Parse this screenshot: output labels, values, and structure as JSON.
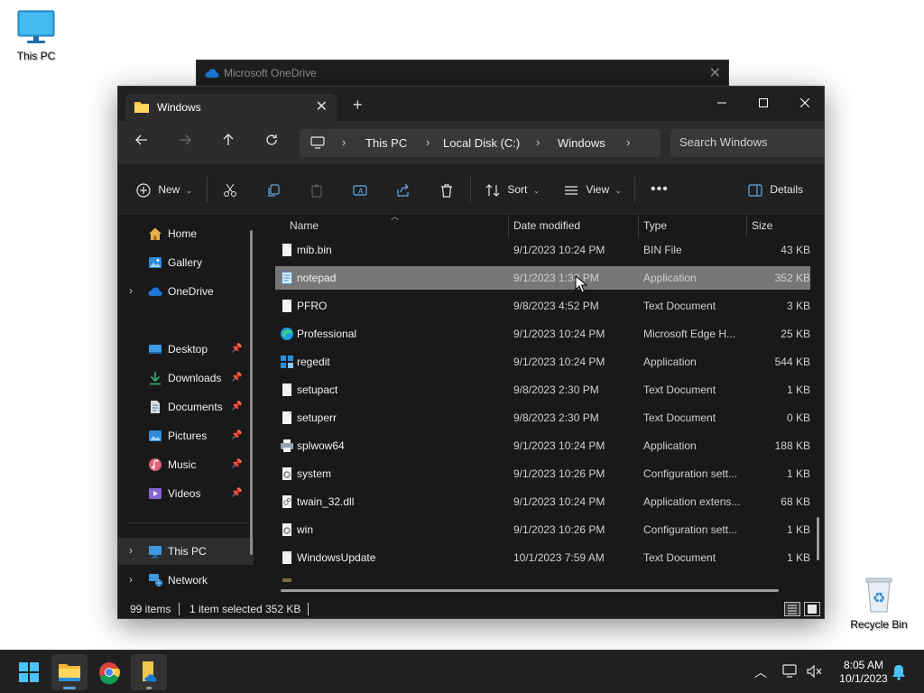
{
  "desktop": {
    "this_pc_label": "This PC",
    "recycle_bin_label": "Recycle Bin"
  },
  "background_window": {
    "title": "Microsoft OneDrive"
  },
  "explorer": {
    "tab_title": "Windows",
    "address": [
      "This PC",
      "Local Disk (C:)",
      "Windows"
    ],
    "search_placeholder": "Search Windows",
    "commands": {
      "new": "New",
      "sort": "Sort",
      "view": "View",
      "details": "Details"
    },
    "nav": {
      "home": "Home",
      "gallery": "Gallery",
      "onedrive": "OneDrive",
      "desktop": "Desktop",
      "downloads": "Downloads",
      "documents": "Documents",
      "pictures": "Pictures",
      "music": "Music",
      "videos": "Videos",
      "this_pc": "This PC",
      "network": "Network"
    },
    "columns": {
      "name": "Name",
      "date": "Date modified",
      "type": "Type",
      "size": "Size"
    },
    "files": [
      {
        "name": "mib.bin",
        "date": "9/1/2023 10:24 PM",
        "type": "BIN File",
        "size": "43 KB",
        "icon": "file-icon"
      },
      {
        "name": "notepad",
        "date": "9/1/2023 1:33 PM",
        "type": "Application",
        "size": "352 KB",
        "icon": "notepad-icon",
        "selected": true
      },
      {
        "name": "PFRO",
        "date": "9/8/2023 4:52 PM",
        "type": "Text Document",
        "size": "3 KB",
        "icon": "file-icon"
      },
      {
        "name": "Professional",
        "date": "9/1/2023 10:24 PM",
        "type": "Microsoft Edge H...",
        "size": "25 KB",
        "icon": "edge-icon"
      },
      {
        "name": "regedit",
        "date": "9/1/2023 10:24 PM",
        "type": "Application",
        "size": "544 KB",
        "icon": "regedit-icon"
      },
      {
        "name": "setupact",
        "date": "9/8/2023 2:30 PM",
        "type": "Text Document",
        "size": "1 KB",
        "icon": "file-icon"
      },
      {
        "name": "setuperr",
        "date": "9/8/2023 2:30 PM",
        "type": "Text Document",
        "size": "0 KB",
        "icon": "file-icon"
      },
      {
        "name": "splwow64",
        "date": "9/1/2023 10:24 PM",
        "type": "Application",
        "size": "188 KB",
        "icon": "printer-icon"
      },
      {
        "name": "system",
        "date": "9/1/2023 10:26 PM",
        "type": "Configuration sett...",
        "size": "1 KB",
        "icon": "config-file-icon"
      },
      {
        "name": "twain_32.dll",
        "date": "9/1/2023 10:24 PM",
        "type": "Application extens...",
        "size": "68 KB",
        "icon": "dll-file-icon"
      },
      {
        "name": "win",
        "date": "9/1/2023 10:26 PM",
        "type": "Configuration sett...",
        "size": "1 KB",
        "icon": "config-file-icon"
      },
      {
        "name": "WindowsUpdate",
        "date": "10/1/2023 7:59 AM",
        "type": "Text Document",
        "size": "1 KB",
        "icon": "file-icon"
      }
    ],
    "status": {
      "items": "99 items",
      "selected": "1 item selected",
      "size": "352 KB"
    }
  },
  "taskbar": {
    "time": "8:05 AM",
    "date": "10/1/2023"
  }
}
